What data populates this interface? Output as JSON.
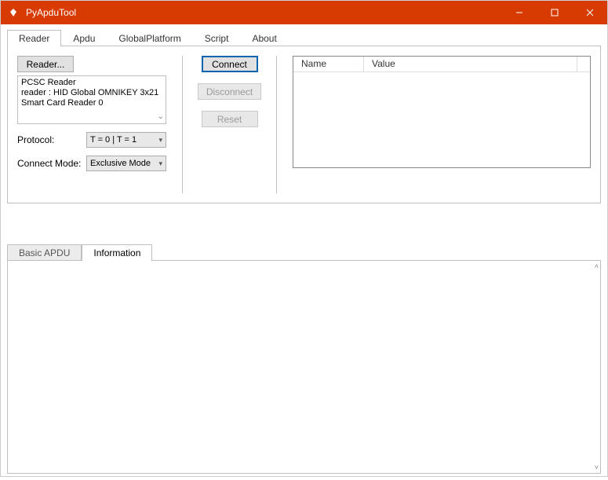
{
  "window": {
    "title": "PyApduTool"
  },
  "top_tabs": {
    "items": [
      "Reader",
      "Apdu",
      "GlobalPlatform",
      "Script",
      "About"
    ],
    "active": 0
  },
  "reader_panel": {
    "reader_button": "Reader...",
    "reader_list_text": "PCSC Reader\nreader : HID Global OMNIKEY 3x21 Smart Card Reader 0",
    "protocol_label": "Protocol:",
    "protocol_value": "T = 0 | T = 1",
    "connect_mode_label": "Connect Mode:",
    "connect_mode_value": "Exclusive Mode"
  },
  "action_buttons": {
    "connect": "Connect",
    "disconnect": "Disconnect",
    "reset": "Reset"
  },
  "grid": {
    "columns": {
      "name": "Name",
      "value": "Value"
    }
  },
  "bottom_tabs": {
    "items": [
      "Basic APDU",
      "Information"
    ],
    "active": 1
  }
}
